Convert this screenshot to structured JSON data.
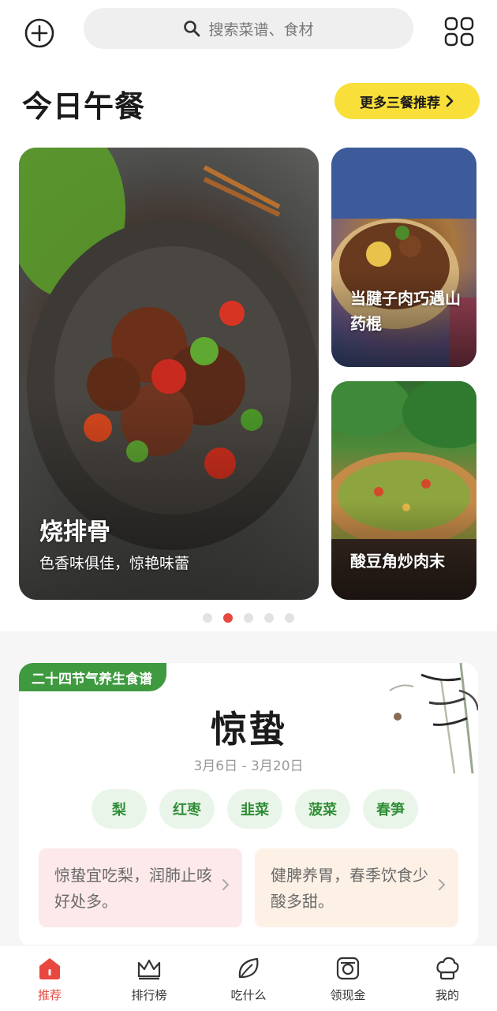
{
  "header": {
    "search_placeholder": "搜索菜谱、食材"
  },
  "lunch": {
    "title": "今日午餐",
    "more_label": "更多三餐推荐",
    "main_card": {
      "name": "烧排骨",
      "subtitle": "色香味俱佳，惊艳味蕾"
    },
    "side_cards": [
      {
        "name": "当腱子肉巧遇山药棍"
      },
      {
        "name": "酸豆角炒肉末"
      }
    ],
    "carousel": {
      "count": 5,
      "active_index": 1
    }
  },
  "season": {
    "tag": "二十四节气养生食谱",
    "term": "惊蛰",
    "date_range": "3月6日 - 3月20日",
    "ingredients": [
      "梨",
      "红枣",
      "韭菜",
      "菠菜",
      "春笋"
    ],
    "tips": [
      "惊蛰宜吃梨，润肺止咳好处多。",
      "健脾养胃，春季饮食少酸多甜。"
    ]
  },
  "tabbar": {
    "items": [
      {
        "label": "推荐",
        "icon": "home-icon",
        "active": true
      },
      {
        "label": "排行榜",
        "icon": "crown-icon",
        "active": false
      },
      {
        "label": "吃什么",
        "icon": "leaf-icon",
        "active": false
      },
      {
        "label": "领现金",
        "icon": "wallet-icon",
        "active": false
      },
      {
        "label": "我的",
        "icon": "chef-hat-icon",
        "active": false
      }
    ]
  },
  "colors": {
    "accent": "#e8483f",
    "yellow": "#f9df3a",
    "green": "#3f9a3f"
  }
}
